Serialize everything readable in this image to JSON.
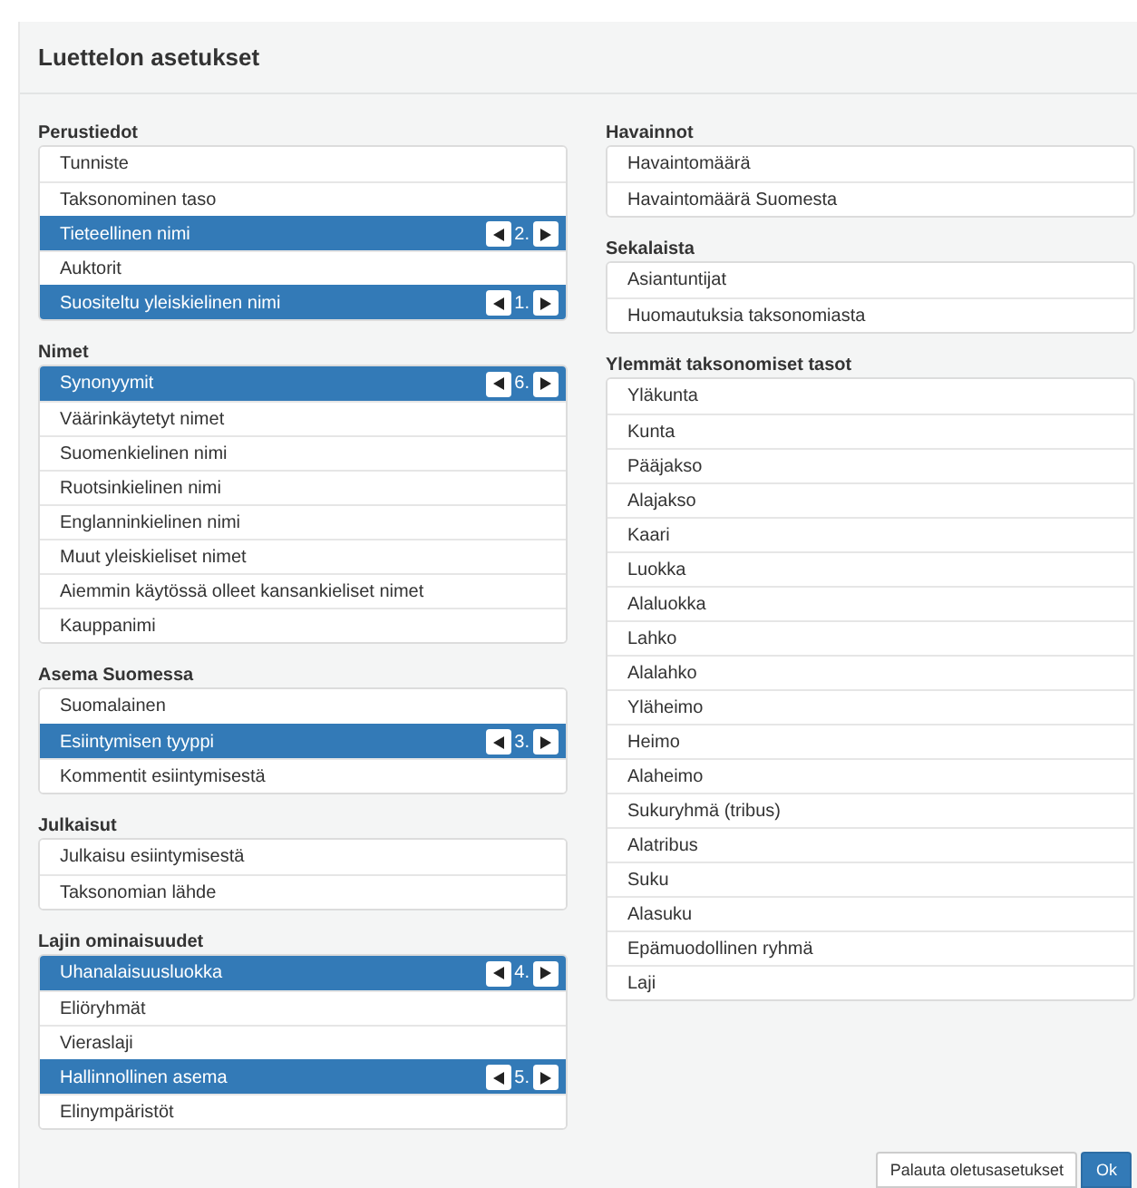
{
  "dialog": {
    "title": "Luettelon asetukset"
  },
  "columns": [
    [
      {
        "title": "Perustiedot",
        "items": [
          {
            "label": "Tunniste",
            "selected": false
          },
          {
            "label": "Taksonominen taso",
            "selected": false
          },
          {
            "label": "Tieteellinen nimi",
            "selected": true,
            "order": "2."
          },
          {
            "label": "Auktorit",
            "selected": false
          },
          {
            "label": "Suositeltu yleiskielinen nimi",
            "selected": true,
            "order": "1."
          }
        ]
      },
      {
        "title": "Nimet",
        "items": [
          {
            "label": "Synonyymit",
            "selected": true,
            "order": "6."
          },
          {
            "label": "Väärinkäytetyt nimet",
            "selected": false
          },
          {
            "label": "Suomenkielinen nimi",
            "selected": false
          },
          {
            "label": "Ruotsinkielinen nimi",
            "selected": false
          },
          {
            "label": "Englanninkielinen nimi",
            "selected": false
          },
          {
            "label": "Muut yleiskieliset nimet",
            "selected": false
          },
          {
            "label": "Aiemmin käytössä olleet kansankieliset nimet",
            "selected": false
          },
          {
            "label": "Kauppanimi",
            "selected": false
          }
        ]
      },
      {
        "title": "Asema Suomessa",
        "items": [
          {
            "label": "Suomalainen",
            "selected": false
          },
          {
            "label": "Esiintymisen tyyppi",
            "selected": true,
            "order": "3."
          },
          {
            "label": "Kommentit esiintymisestä",
            "selected": false
          }
        ]
      },
      {
        "title": "Julkaisut",
        "items": [
          {
            "label": "Julkaisu esiintymisestä",
            "selected": false
          },
          {
            "label": "Taksonomian lähde",
            "selected": false
          }
        ]
      },
      {
        "title": "Lajin ominaisuudet",
        "items": [
          {
            "label": "Uhanalaisuusluokka",
            "selected": true,
            "order": "4."
          },
          {
            "label": "Eliöryhmät",
            "selected": false
          },
          {
            "label": "Vieraslaji",
            "selected": false
          },
          {
            "label": "Hallinnollinen asema",
            "selected": true,
            "order": "5."
          },
          {
            "label": "Elinympäristöt",
            "selected": false
          }
        ]
      }
    ],
    [
      {
        "title": "Havainnot",
        "items": [
          {
            "label": "Havaintomäärä",
            "selected": false
          },
          {
            "label": "Havaintomäärä Suomesta",
            "selected": false
          }
        ]
      },
      {
        "title": "Sekalaista",
        "items": [
          {
            "label": "Asiantuntijat",
            "selected": false
          },
          {
            "label": "Huomautuksia taksonomiasta",
            "selected": false
          }
        ]
      },
      {
        "title": "Ylemmät taksonomiset tasot",
        "items": [
          {
            "label": "Yläkunta",
            "selected": false
          },
          {
            "label": "Kunta",
            "selected": false
          },
          {
            "label": "Pääjakso",
            "selected": false
          },
          {
            "label": "Alajakso",
            "selected": false
          },
          {
            "label": "Kaari",
            "selected": false
          },
          {
            "label": "Luokka",
            "selected": false
          },
          {
            "label": "Alaluokka",
            "selected": false
          },
          {
            "label": "Lahko",
            "selected": false
          },
          {
            "label": "Alalahko",
            "selected": false
          },
          {
            "label": "Yläheimo",
            "selected": false
          },
          {
            "label": "Heimo",
            "selected": false
          },
          {
            "label": "Alaheimo",
            "selected": false
          },
          {
            "label": "Sukuryhmä (tribus)",
            "selected": false
          },
          {
            "label": "Alatribus",
            "selected": false
          },
          {
            "label": "Suku",
            "selected": false
          },
          {
            "label": "Alasuku",
            "selected": false
          },
          {
            "label": "Epämuodollinen ryhmä",
            "selected": false
          },
          {
            "label": "Laji",
            "selected": false
          }
        ]
      }
    ]
  ],
  "buttons": [
    {
      "label": "Palauta oletusasetukset",
      "kind": "default"
    },
    {
      "label": "Ok",
      "kind": "primary"
    }
  ]
}
